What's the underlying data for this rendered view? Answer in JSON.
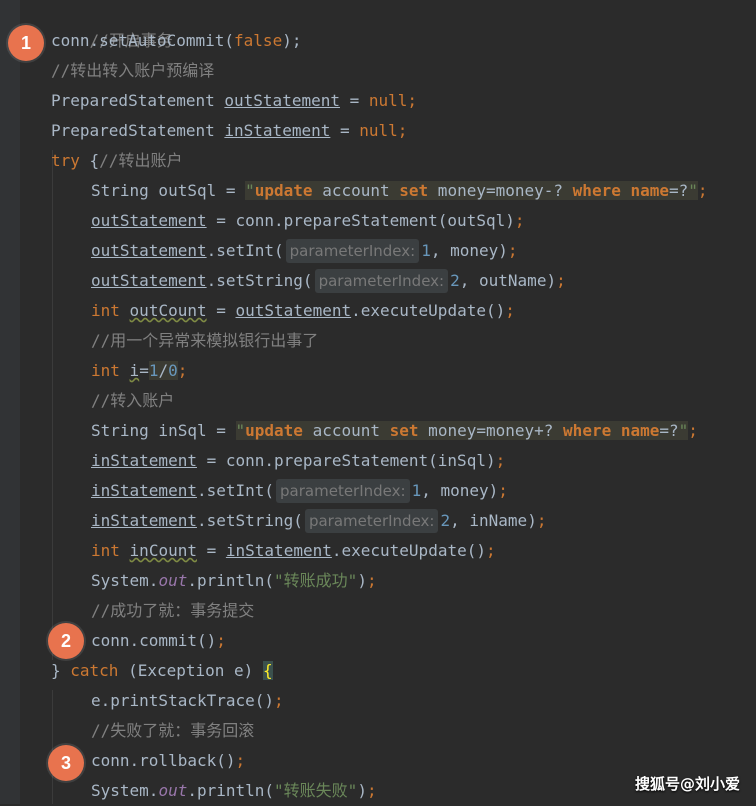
{
  "code": {
    "l1": "//开启事务",
    "l2a": "conn.setAutoCommit(",
    "l2b": "false",
    "l2c": ");",
    "l3": "//转出转入账户预编译",
    "l4a": "PreparedStatement ",
    "l4b": "outStatement",
    "l4c": " = ",
    "l4d": "null",
    "l4e": ";",
    "l5a": "PreparedStatement ",
    "l5b": "inStatement",
    "l5c": " = ",
    "l5d": "null",
    "l5e": ";",
    "l6a": "try",
    "l6b": " {",
    "l6c": "//转出账户",
    "l7a": "String outSql = ",
    "l7q": "\"",
    "l7b": "update",
    "l7c": " account ",
    "l7d": "set",
    "l7e": " money=money-? ",
    "l7f": "where",
    "l7g": " ",
    "l7h": "name",
    "l7i": "=?",
    "l7j": "\"",
    "l7k": ";",
    "l8a": "outStatement",
    "l8b": " = conn.prepareStatement(outSql)",
    "l8c": ";",
    "l9a": "outStatement",
    "l9b": ".setInt(",
    "l9hint": "parameterIndex:",
    "l9c": "1",
    "l9d": ", money)",
    "l9e": ";",
    "l10a": "outStatement",
    "l10b": ".setString(",
    "l10hint": "parameterIndex:",
    "l10c": "2",
    "l10d": ", outName)",
    "l10e": ";",
    "l11a": "int",
    "l11b": " ",
    "l11c": "outCount",
    "l11d": " = ",
    "l11e": "outStatement",
    "l11f": ".executeUpdate()",
    "l11g": ";",
    "l12": "//用一个异常来模拟银行出事了",
    "l13a": "int",
    "l13b": " ",
    "l13c": "i",
    "l13d": "=",
    "l13e": "1",
    "l13f": "/",
    "l13g": "0",
    "l13h": ";",
    "l14": "//转入账户",
    "l15a": "String inSql = ",
    "l15q": "\"",
    "l15b": "update",
    "l15c": " account ",
    "l15d": "set",
    "l15e": " money=money+? ",
    "l15f": "where",
    "l15g": " ",
    "l15h": "name",
    "l15i": "=?",
    "l15j": "\"",
    "l15k": ";",
    "l16a": "inStatement",
    "l16b": " = conn.prepareStatement(inSql)",
    "l16c": ";",
    "l17a": "inStatement",
    "l17b": ".setInt(",
    "l17hint": "parameterIndex:",
    "l17c": "1",
    "l17d": ", money)",
    "l17e": ";",
    "l18a": "inStatement",
    "l18b": ".setString(",
    "l18hint": "parameterIndex:",
    "l18c": "2",
    "l18d": ", inName)",
    "l18e": ";",
    "l19a": "int",
    "l19b": " ",
    "l19c": "inCount",
    "l19d": " = ",
    "l19e": "inStatement",
    "l19f": ".executeUpdate()",
    "l19g": ";",
    "l20a": "System.",
    "l20b": "out",
    "l20c": ".println(",
    "l20d": "\"转账成功\"",
    "l20e": ")",
    "l20f": ";",
    "l21": "//成功了就：事务提交",
    "l22a": "conn.commit()",
    "l22b": ";",
    "l23a": "} ",
    "l23b": "catch",
    "l23c": " (Exception e) ",
    "l23d": "{",
    "l24a": "e.printStackTrace()",
    "l24b": ";",
    "l25": "//失败了就：事务回滚",
    "l26a": "conn.rollback()",
    "l26b": ";",
    "l27a": "System.",
    "l27b": "out",
    "l27c": ".println(",
    "l27d": "\"转账失败\"",
    "l27e": ")",
    "l27f": ";"
  },
  "badges": [
    "1",
    "2",
    "3"
  ],
  "watermark": "搜狐号@刘小爱",
  "colors": {
    "background": "#2b2b2b",
    "comment": "#808080",
    "keyword": "#cc7832",
    "number": "#6897bb",
    "string": "#6a8759",
    "badge": "#e8734e"
  }
}
